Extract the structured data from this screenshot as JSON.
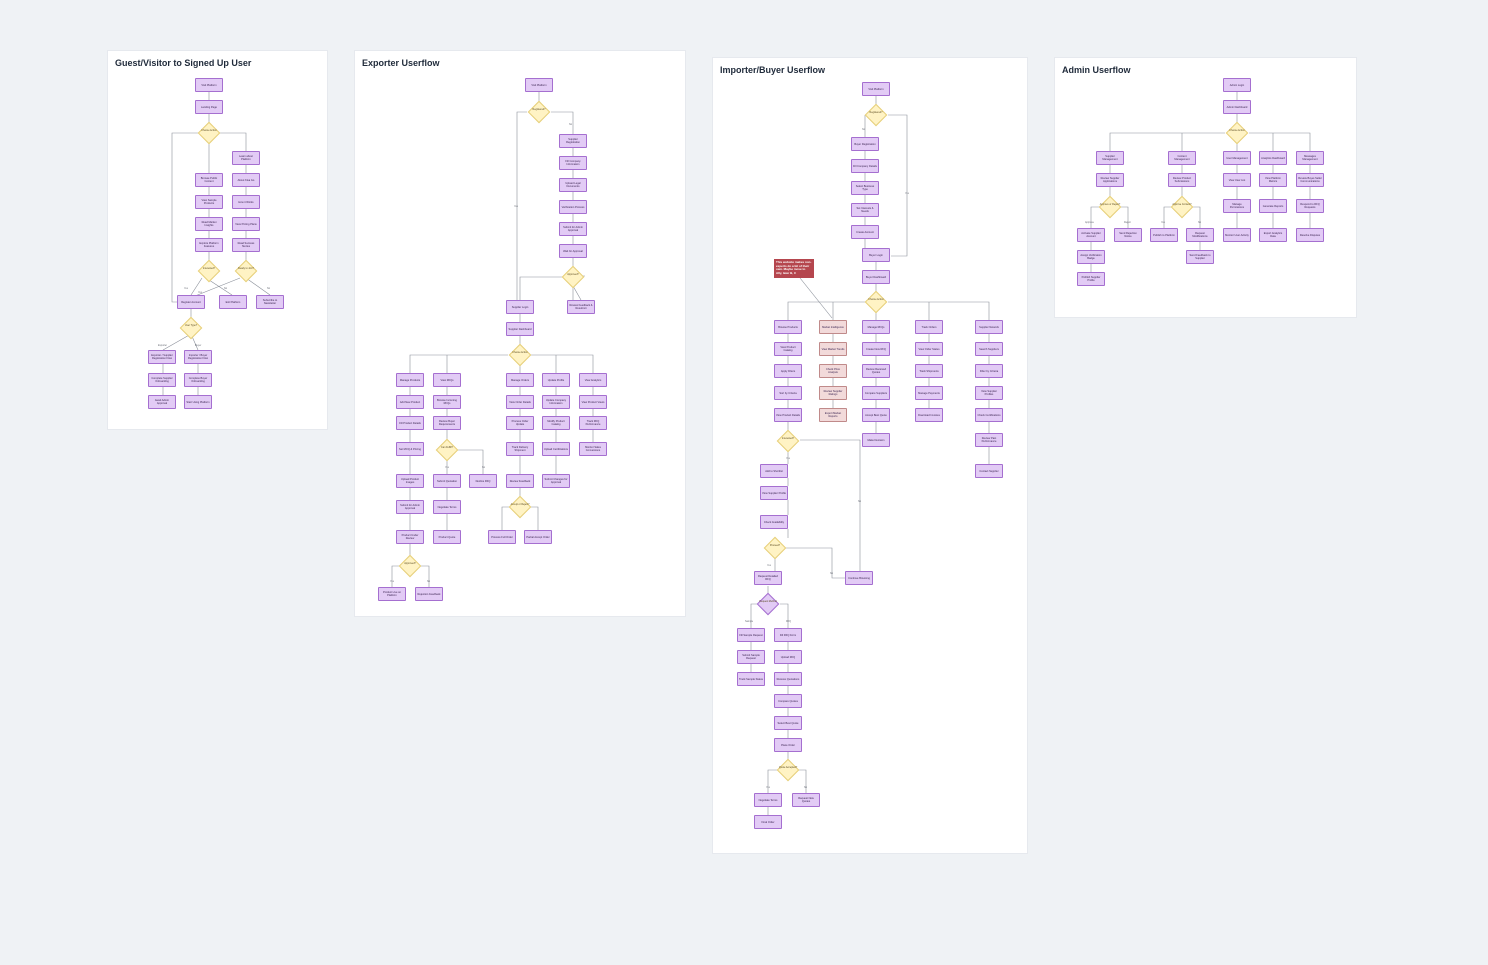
{
  "frames": {
    "guest": {
      "title": "Guest/Visitor to Signed Up User"
    },
    "exporter": {
      "title": "Exporter Userflow"
    },
    "importer": {
      "title": "Importer/Buyer Userflow"
    },
    "admin": {
      "title": "Admin Userflow"
    }
  },
  "note": "This website makes non-experts do a bit of their own. Maybe move to Ally, later B, C",
  "guest": {
    "visit": "Visit Platform",
    "landing": "Landing Page",
    "choose": "Choose Action",
    "learn": "Learn about Platform",
    "browse": "Browse Public Content",
    "about": "About Kisa Go",
    "view_products": "View Sample Products",
    "how": "How it Works",
    "read": "Read Market Insights",
    "pricing": "View Pricing Plans",
    "explore": "Explore Platform Features",
    "success": "Read Success Stories",
    "interested": "Interested?",
    "ready": "Ready to Join?",
    "register": "Register Account",
    "exit": "Exit Platform",
    "subscribe": "Subscribe to Newsletter",
    "user_type": "User Type?",
    "exp_reg": "Exporter / Supplier Registration Flow",
    "imp_reg": "Importer / Buyer Registration Flow",
    "complete_sup": "Complete Supplier Onboarding",
    "complete_buyer": "Complete Buyer Onboarding",
    "await": "Await Admin Approval",
    "start": "Start Using Platform",
    "l_yes1": "Yes",
    "l_no1": "No",
    "l_yes2": "Yes",
    "l_no2": "No",
    "l_exporter": "Exporter",
    "l_buyer": "Buyer"
  },
  "exporter": {
    "visit": "Visit Platform",
    "registered": "Registered?",
    "sup_reg": "Supplier Registration",
    "fill": "Fill Company Information",
    "upload": "Upload Legal Documents",
    "verify": "Verification Process",
    "submit": "Submit for Admin Approval",
    "wait": "Wait for Approval",
    "approved": "Approved?",
    "login": "Supplier Login",
    "review": "Review Feedback & Resubmit",
    "dash": "Supplier Dashboard",
    "choose": "Choose Action",
    "manage_products": "Manage Products",
    "view_rfqs": "View RFQs",
    "manage_orders": "Manage Orders",
    "update_profile": "Update Profile",
    "view_analytics": "View Analytics",
    "add_product": "Add New Product",
    "browse_rfqs": "Browse Incoming RFQs",
    "view_order": "View Order Details",
    "update_info": "Update Company Information",
    "view_sales": "View Product Views",
    "fill_details": "Fill Product Details",
    "review_req": "Review Buyer Requirements",
    "process_order": "Process Order Update",
    "modify": "Modify Product Catalog",
    "track_rfq": "Track RFQ Performance",
    "set_moq": "Set MOQ & Pricing",
    "can_fulfil": "Can Fulfill?",
    "track_ship": "Track Delivery Shipment",
    "upload_cert": "Upload Certifications",
    "monitor": "Monitor Sales Conversions",
    "upload_images": "Upload Product Images",
    "submit_q": "Submit Quotation",
    "decline": "Decline RFQ",
    "review_feedback": "Review Feedback",
    "submit_changes": "Submit Changes for Approval",
    "submit_approval": "Submit for Admin Approval",
    "negotiate": "Negotiate Terms",
    "accept": "Accept or Reject?",
    "product_review": "Product Under Review",
    "product_quote": "Product Quote",
    "process_fulfil": "Process Full Order",
    "partial": "Partial Accept Order",
    "approved2": "Approved?",
    "live": "Product Live on Platform",
    "reject_notice": "Rejection Feedback",
    "l_no": "No",
    "l_yes": "Yes",
    "l_yes2": "Yes",
    "l_no2": "No",
    "l_yes3": "Yes",
    "l_no3": "No"
  },
  "importer": {
    "visit": "Visit Platform",
    "registered": "Registered?",
    "buyer_reg": "Buyer Registration",
    "fill": "Fill Company Details",
    "select": "Select Business Type",
    "interests": "Set Interests & Needs",
    "create": "Create Account",
    "login": "Buyer Login",
    "dash": "Buyer Dashboard",
    "choose": "Choose Action",
    "browse": "Browse Products",
    "market": "Market Intelligence",
    "manage_rfqs": "Manage RFQs",
    "track_orders": "Track Orders",
    "sup_network": "Supplier Network",
    "view_catalog": "View Product Catalog",
    "view_trends": "View Market Trends",
    "create_rfq": "Create New RFQ",
    "view_status": "View Order Status",
    "search_sup": "Search Suppliers",
    "apply": "Apply Filters",
    "check_price": "Check Price Analysis",
    "review_quotes": "Review Received Quotes",
    "track_shipments": "Track Shipments",
    "filter_cat": "Filter by Criteria",
    "sort": "Sort by Criteria",
    "review_insights": "Review Supplier Ratings",
    "compare": "Compare Suppliers",
    "manage_pay": "Manage Payments",
    "view_profiles": "View Supplier Profiles",
    "view_details": "View Product Details",
    "export": "Export Market Reports",
    "accept_quote": "Accept Best Quote",
    "download": "Download Invoices",
    "check_cert": "Check Certifications",
    "interested": "Interested?",
    "make_order": "Make Decision",
    "review_perf": "Review Past Performance",
    "add_list": "Add to Shortlist",
    "contact": "Contact Supplier",
    "view_sup": "View Supplier Profile",
    "check_avail": "Check Availability",
    "proceed": "Proceed?",
    "request": "Request Detailed RFQ",
    "continue": "Continue Browsing",
    "method": "Request Method",
    "fill_sample": "Fill Sample Request",
    "fill_rfq": "Fill RFQ Form",
    "submit_sample": "Submit Sample Request",
    "upload_rfq": "Upload RFQ",
    "track_sample": "Track Sample Status",
    "receive": "Receive Quotations",
    "compare_q": "Compare Quotes",
    "select_best": "Select Best Quote",
    "place": "Place Order",
    "quote_ok": "Quote Accepted?",
    "negotiate": "Negotiate Terms",
    "request_new": "Request New Quotes",
    "final": "Final Order",
    "l_no": "No",
    "l_yes": "Yes",
    "l_yes2": "Yes",
    "l_no2": "No",
    "l_yes3": "Yes",
    "l_no3": "No",
    "l_sample": "Sample",
    "l_rfq": "RFQ",
    "l_yes4": "Yes",
    "l_no4": "No"
  },
  "admin": {
    "login": "Admin Login",
    "dash": "Admin Dashboard",
    "choose": "Choose Action",
    "sup_mgmt": "Supplier Management",
    "content": "Content Management",
    "user_mgmt": "User Management",
    "analytics": "Analytics Dashboard",
    "messages": "Messages Management",
    "review_apps": "Review Supplier Applications",
    "review_products": "Review Product Submissions",
    "view_users": "View User List",
    "view_metrics": "View Platform Metrics",
    "review_msgs": "Review Buyer-Seller Communications",
    "sup_approve": "Approve or Reject?",
    "prod_approve": "Approve Content?",
    "manage_perm": "Manage Permissions",
    "gen_reports": "Generate Reports",
    "respond": "Respond to RFQ Requests",
    "activate": "Activate Supplier Account",
    "send_reason": "Send Rejection Notice",
    "publish": "Publish to Platform",
    "request_mod": "Request Modifications",
    "monitor": "Monitor User Activity",
    "export": "Export Analytics Data",
    "resolve": "Resolve Disputes",
    "assign": "Assign Verification Badge",
    "send_feedback": "Send Feedback to Supplier",
    "publish_profile": "Publish Supplier Profile",
    "l_approve": "Approve",
    "l_reject": "Reject",
    "l_yes": "Yes",
    "l_no": "No"
  }
}
